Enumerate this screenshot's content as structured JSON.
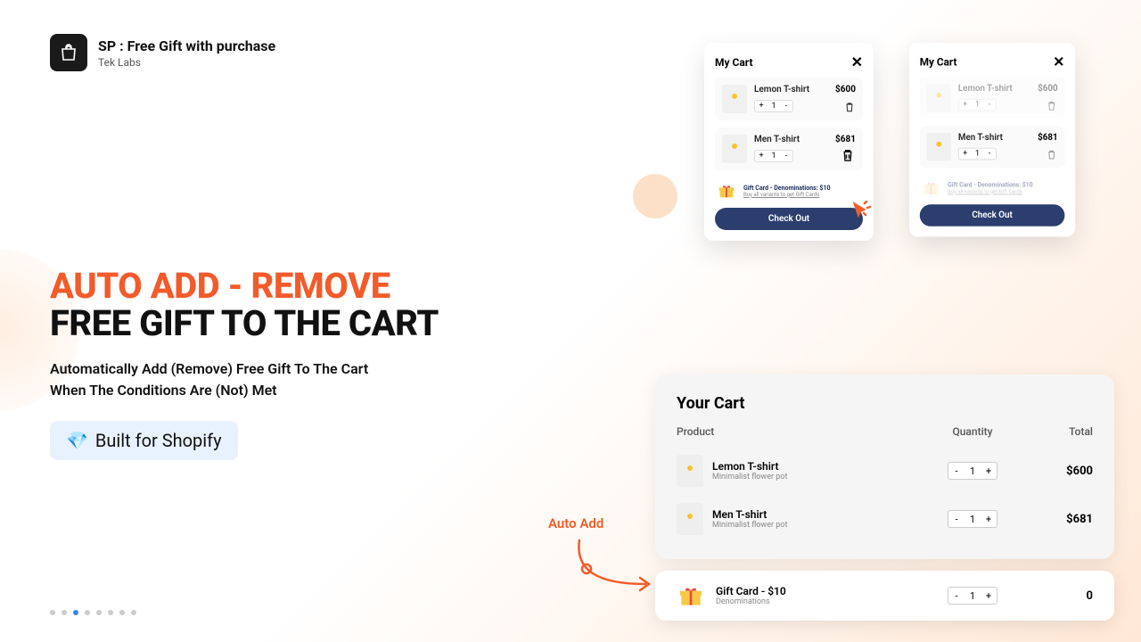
{
  "app": {
    "title": "SP : Free Gift with purchase",
    "subtitle": "Tek Labs"
  },
  "hero": {
    "line1": "AUTO ADD - REMOVE",
    "line2": "FREE GIFT TO THE CART",
    "desc1": "Automatically Add (Remove) Free Gift To The Cart",
    "desc2": "When The Conditions Are (Not) Met",
    "badge_icon": "💎",
    "badge_text": "Built for Shopify"
  },
  "mini_cart": {
    "title": "My Cart",
    "item1_name": "Lemon T-shirt",
    "item1_price": "$600",
    "item1_qty": "1",
    "item2_name": "Men T-shirt",
    "item2_price": "$681",
    "item2_qty": "1",
    "gift_text": "Gift Card - Denominations: $10",
    "gift_sub": "Buy all variants to get Gift Cards",
    "checkout": "Check Out"
  },
  "autoadd_label": "Auto Add",
  "big_cart": {
    "title": "Your Cart",
    "h_product": "Product",
    "h_qty": "Quantity",
    "h_total": "Total",
    "rows": [
      {
        "name": "Lemon T-shirt",
        "sub": "Minimalist flower pot",
        "qty": "1",
        "total": "$600"
      },
      {
        "name": "Men T-shirt",
        "sub": "Minimalist flower pot",
        "qty": "1",
        "total": "$681"
      }
    ]
  },
  "gift_card": {
    "name": "Gift Card - $10",
    "sub": "Denominations",
    "qty": "1",
    "total": "0"
  },
  "symbols": {
    "plus": "+",
    "minus": "-"
  }
}
